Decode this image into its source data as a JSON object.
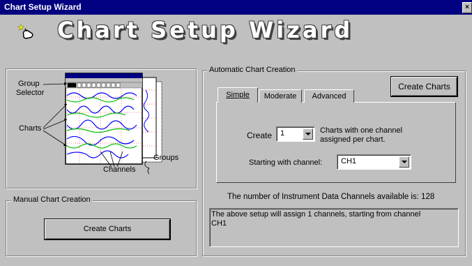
{
  "window": {
    "title": "Chart Setup Wizard",
    "close_glyph": "×"
  },
  "banner": {
    "title": "Chart Setup Wizard",
    "icon": "wand-hand-icon"
  },
  "diagram": {
    "labels": {
      "group_selector_line1": "Group",
      "group_selector_line2": "Selector",
      "charts": "Charts",
      "channels": "Channels",
      "groups": "Groups"
    }
  },
  "manual": {
    "legend": "Manual Chart Creation",
    "button": "Create Charts"
  },
  "automatic": {
    "legend": "Automatic Chart Creation",
    "create_button": "Create Charts",
    "tabs": [
      {
        "label": "Simple",
        "selected": true
      },
      {
        "label": "Moderate",
        "selected": false
      },
      {
        "label": "Advanced",
        "selected": false
      }
    ],
    "create_label": "Create",
    "create_value": "1",
    "charts_desc_line1": "Charts with one channel",
    "charts_desc_line2": "assigned per chart.",
    "starting_label": "Starting with channel:",
    "starting_value": "CH1",
    "available_text": "The number of Instrument Data Channels available is: 128",
    "summary_line1": "The above setup will assign 1 channels, starting from channel",
    "summary_line2": "CH1"
  },
  "colors": {
    "titlebar": "#000080",
    "face": "#c0c0c0",
    "wave_blue": "#0000ff",
    "wave_green": "#00c000",
    "grid_red": "#ff0000"
  }
}
